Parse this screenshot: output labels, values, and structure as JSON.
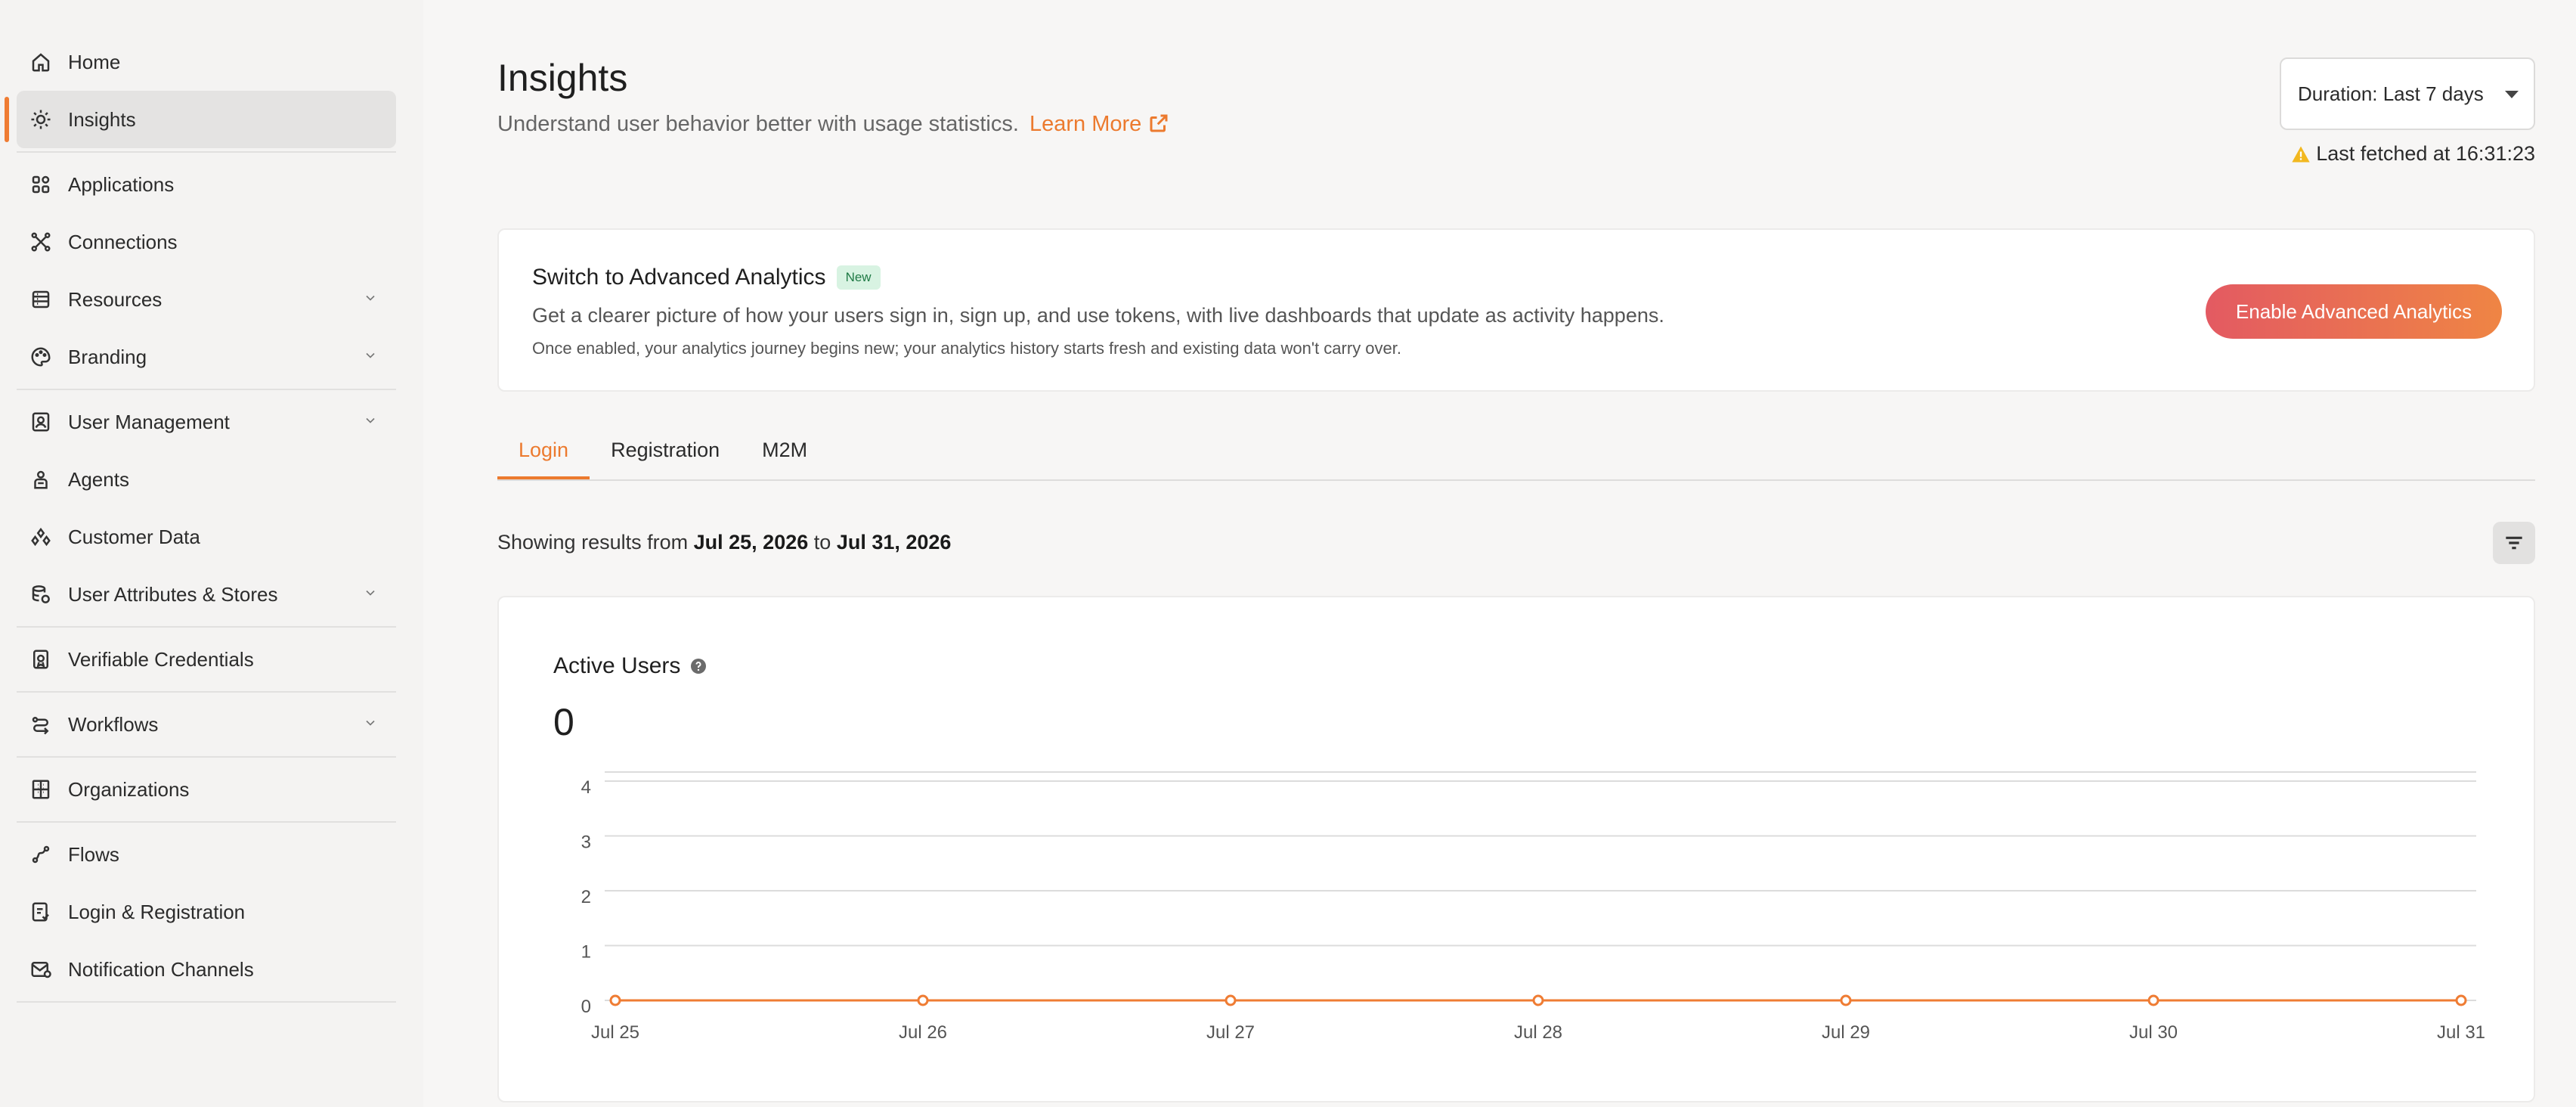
{
  "sidebar": {
    "items": [
      {
        "label": "Home",
        "icon": "home-icon",
        "chevron": false
      },
      {
        "label": "Insights",
        "icon": "lightbulb-icon",
        "chevron": false,
        "active": true
      },
      {
        "label": "Applications",
        "icon": "grid-icon",
        "chevron": false
      },
      {
        "label": "Connections",
        "icon": "network-icon",
        "chevron": false
      },
      {
        "label": "Resources",
        "icon": "server-icon",
        "chevron": true
      },
      {
        "label": "Branding",
        "icon": "palette-icon",
        "chevron": true
      },
      {
        "label": "User Management",
        "icon": "user-card-icon",
        "chevron": true
      },
      {
        "label": "Agents",
        "icon": "agent-icon",
        "chevron": false
      },
      {
        "label": "Customer Data",
        "icon": "data-icon",
        "chevron": false
      },
      {
        "label": "User Attributes & Stores",
        "icon": "database-icon",
        "chevron": true
      },
      {
        "label": "Verifiable Credentials",
        "icon": "credential-icon",
        "chevron": false
      },
      {
        "label": "Workflows",
        "icon": "workflow-icon",
        "chevron": true
      },
      {
        "label": "Organizations",
        "icon": "building-icon",
        "chevron": false
      },
      {
        "label": "Flows",
        "icon": "flow-icon",
        "chevron": false
      },
      {
        "label": "Login & Registration",
        "icon": "login-icon",
        "chevron": false
      },
      {
        "label": "Notification Channels",
        "icon": "notification-icon",
        "chevron": false
      }
    ]
  },
  "header": {
    "title": "Insights",
    "subtitle": "Understand user behavior better with usage statistics.",
    "learn_more": "Learn More",
    "duration": "Duration: Last 7 days",
    "last_fetched": "Last fetched at 16:31:23"
  },
  "banner": {
    "title": "Switch to Advanced Analytics",
    "badge": "New",
    "description": "Get a clearer picture of how your users sign in, sign up, and use tokens, with live dashboards that update as activity happens.",
    "note": "Once enabled, your analytics journey begins new; your analytics history starts fresh and existing data won't carry over.",
    "button": "Enable Advanced Analytics"
  },
  "tabs": [
    {
      "label": "Login",
      "active": true
    },
    {
      "label": "Registration",
      "active": false
    },
    {
      "label": "M2M",
      "active": false
    }
  ],
  "results": {
    "prefix": "Showing results from",
    "from": "Jul 25, 2026",
    "joiner": "to",
    "to": "Jul 31, 2026"
  },
  "chart_card": {
    "title": "Active Users",
    "value": "0"
  },
  "chart_data": {
    "type": "line",
    "title": "Active Users",
    "categories": [
      "Jul 25",
      "Jul 26",
      "Jul 27",
      "Jul 28",
      "Jul 29",
      "Jul 30",
      "Jul 31"
    ],
    "series": [
      {
        "values": [
          0,
          0,
          0,
          0,
          0,
          0,
          0
        ],
        "color": "#ef7c33"
      }
    ],
    "yticks": [
      0,
      1,
      2,
      3,
      4
    ],
    "ylim": [
      0,
      4
    ],
    "xlabel": "",
    "ylabel": "",
    "grid": true
  },
  "colors": {
    "accent": "#ec7a2e",
    "line": "#ef7c33",
    "badge_bg": "#d8f3e2"
  }
}
